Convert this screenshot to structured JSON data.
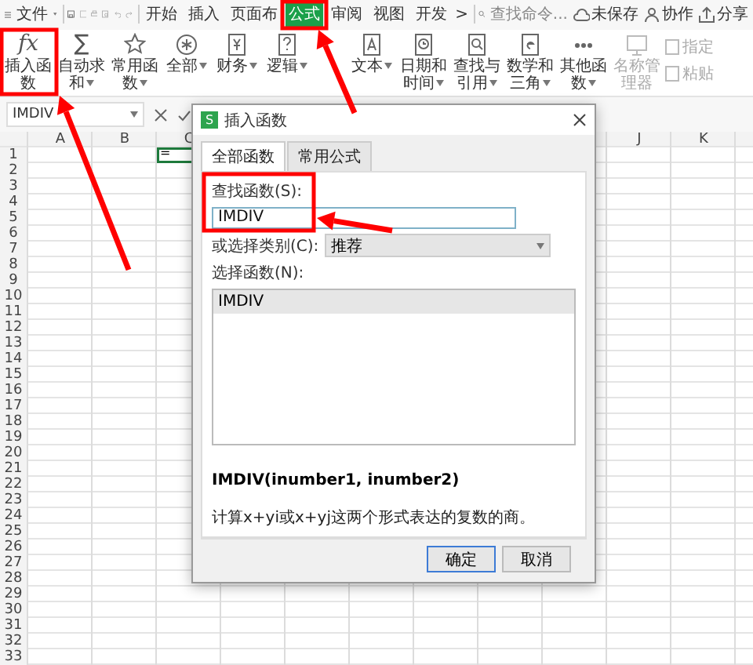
{
  "menu": {
    "label": "文件"
  },
  "tabs": [
    {
      "label": "开始",
      "selected": false
    },
    {
      "label": "插入",
      "selected": false
    },
    {
      "label": "页面布",
      "selected": false
    },
    {
      "label": "公式",
      "selected": true
    },
    {
      "label": "审阅",
      "selected": false
    },
    {
      "label": "视图",
      "selected": false
    },
    {
      "label": "开发",
      "selected": false
    }
  ],
  "tabs_more": ">",
  "search": {
    "placeholder": "查找命令..."
  },
  "top_actions": [
    {
      "label": "未保存",
      "kind": "cloud"
    },
    {
      "label": "协作",
      "kind": "person"
    },
    {
      "label": "分享",
      "kind": "share"
    }
  ],
  "ribbon": [
    {
      "label": "插入函数",
      "glyph": "fx",
      "kind": "serif",
      "dropdown": false,
      "disabled": false
    },
    {
      "label": "自动求和",
      "glyph": "∑",
      "kind": "sans",
      "dropdown": true,
      "disabled": false
    },
    {
      "label": "常用函数",
      "kind": "star",
      "dropdown": true,
      "disabled": false
    },
    {
      "label": "全部",
      "kind": "asterisk",
      "dropdown": true,
      "disabled": false
    },
    {
      "label": "财务",
      "kind": "yen",
      "dropdown": true,
      "disabled": false
    },
    {
      "label": "逻辑",
      "kind": "question",
      "dropdown": true,
      "disabled": false
    },
    {
      "label": "文本",
      "kind": "letter",
      "dropdown": true,
      "disabled": false
    },
    {
      "label": "日期和时间",
      "kind": "clock",
      "dropdown": true,
      "disabled": false
    },
    {
      "label": "查找与引用",
      "kind": "search",
      "dropdown": true,
      "disabled": false
    },
    {
      "label": "数学和三角",
      "kind": "math",
      "dropdown": true,
      "disabled": false
    },
    {
      "label": "其他函数",
      "kind": "more",
      "dropdown": true,
      "disabled": false
    },
    {
      "label": "名称管理器",
      "kind": "card",
      "dropdown": false,
      "disabled": true
    }
  ],
  "ribbon_small": [
    {
      "label": "指定",
      "disabled": true
    },
    {
      "label": "粘贴",
      "disabled": true
    }
  ],
  "formula_bar": {
    "name_box": "IMDIV"
  },
  "sheet": {
    "left_columns": [
      "A",
      "B",
      "C"
    ],
    "right_columns": [
      "J",
      "K"
    ],
    "rows": [
      "1",
      "2",
      "3",
      "4",
      "5",
      "6",
      "7",
      "8",
      "9",
      "10",
      "11",
      "12",
      "13",
      "14",
      "15",
      "16",
      "17",
      "18",
      "19",
      "20",
      "21",
      "22",
      "23",
      "24",
      "25",
      "26",
      "27",
      "28",
      "29",
      "30",
      "31",
      "32",
      "33"
    ],
    "active_cell": {
      "value": "="
    }
  },
  "dialog": {
    "badge": "S",
    "title": "插入函数",
    "tabs": [
      {
        "label": "全部函数",
        "selected": true
      },
      {
        "label": "常用公式",
        "selected": false
      }
    ],
    "search_label": "查找函数(S):",
    "search_value": "IMDIV",
    "category_label": "或选择类别(C):",
    "category_value": "推荐",
    "list_label": "选择函数(N):",
    "functions": [
      {
        "name": "IMDIV",
        "selected": true
      }
    ],
    "signature": "IMDIV(inumber1, inumber2)",
    "description": "计算x+yi或x+yj这两个形式表达的复数的商。",
    "buttons": [
      {
        "label": "确定",
        "kind": "primary"
      },
      {
        "label": "取消",
        "kind": "normal"
      }
    ]
  }
}
